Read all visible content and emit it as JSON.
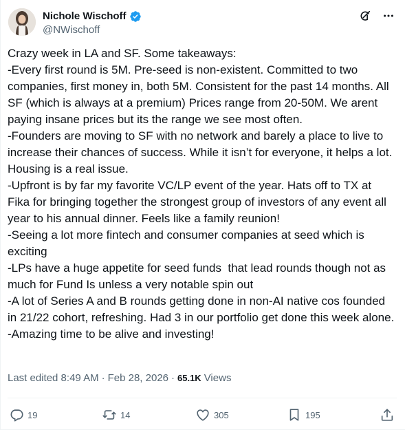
{
  "author": {
    "display_name": "Nichole Wischoff",
    "handle": "@NWischoff"
  },
  "icons": {
    "avatar": "avatar",
    "verified": "verified-badge-icon",
    "grok": "grok-icon",
    "more": "more-icon",
    "reply": "reply-icon",
    "repost": "repost-icon",
    "like": "like-icon",
    "bookmark": "bookmark-icon",
    "share": "share-icon"
  },
  "colors": {
    "text": "#0f1419",
    "secondary": "#536471",
    "verified": "#1d9bf0"
  },
  "post": {
    "text": "Crazy week in LA and SF. Some takeaways:\n-Every first round is 5M. Pre-seed is non-existent. Committed to two companies, first money in, both 5M. Consistent for the past 14 months. All SF (which is always at a premium) Prices range from 20-50M. We arent paying insane prices but its the range we see most often.\n-Founders are moving to SF with no network and barely a place to live to increase their chances of success. While it isn’t for everyone, it helps a lot. Housing is a real issue.\n-Upfront is by far my favorite VC/LP event of the year. Hats off to TX at Fika for bringing together the strongest group of investors of any event all year to his annual dinner. Feels like a family reunion!\n-Seeing a lot more fintech and consumer companies at seed which is exciting\n-LPs have a huge appetite for seed funds  that lead rounds though not as much for Fund Is unless a very notable spin out\n-A lot of Series A and B rounds getting done in non-AI native cos founded in 21/22 cohort, refreshing. Had 3 in our portfolio get done this week alone.\n-Amazing time to be alive and investing!"
  },
  "meta": {
    "edited": "Last edited 8:49 AM",
    "separator": "·",
    "date": "Feb 28, 2026",
    "views_count": "65.1K",
    "views_label": "Views"
  },
  "actions": {
    "replies": "19",
    "reposts": "14",
    "likes": "305",
    "bookmarks": "195"
  }
}
